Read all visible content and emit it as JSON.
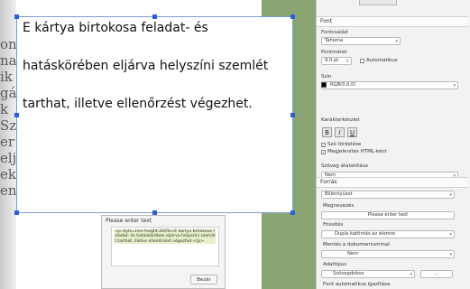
{
  "document": {
    "side_fragments": [
      "on",
      "na",
      "ik",
      "gál",
      "k",
      "Sze",
      "er",
      "eljá",
      "ek",
      "en"
    ],
    "textbox_lines": [
      "E kártya birtokosa feladat- és",
      "hatáskörében eljárva helyszíni szemlét",
      "tarthat, illetve ellenőrzést végezhet."
    ]
  },
  "dialog": {
    "title": "Please enter text",
    "code": "<p style=line-height:200%>E kártya birtokosa feladat- és hatáskörében eljárva helyszíni szemlét tarthat, illetve ellenőrzést végezhet.</p>",
    "ok_label": "Bezár"
  },
  "panel": {
    "font_section": "Font",
    "font_family_label": "Fontcsalád",
    "font_family_value": "Tahoma",
    "font_size_label": "Pontméret",
    "font_size_value": "9.0 pt",
    "auto_label": "Automatikus",
    "color_label": "Szín",
    "color_value": "RGB(0,0,0)",
    "charset_label": "Karakterkészlet",
    "bold_label": "B",
    "italic_label": "I",
    "underline_label": "U",
    "word_wrap_label": "Szó tördelése",
    "html_label": "Megjelenítés HTML-ként",
    "transform_label": "Szöveg átalakítása",
    "transform_value": "Nem",
    "dash": "-",
    "source_section": "Forrás",
    "source_value": "Billentyűzet",
    "prompt_label": "Megnevezés",
    "prompt_value": "Please enter text",
    "trigger_label": "Frissítés",
    "trigger_value": "Dupla kattintás az elemre",
    "save_label": "Mentés a dokumentummal",
    "save_value": "Nem",
    "datatype_label": "Adattípus",
    "datatype_value": "Szövegdoboz",
    "ellipsis": "...",
    "auto_font_label": "Font automatikus igazítása"
  },
  "colors": {
    "background": "#8aa574",
    "selection_border": "#7b9fd6",
    "handle": "#2f5fd6",
    "code_highlight": "#e5f0c8"
  }
}
